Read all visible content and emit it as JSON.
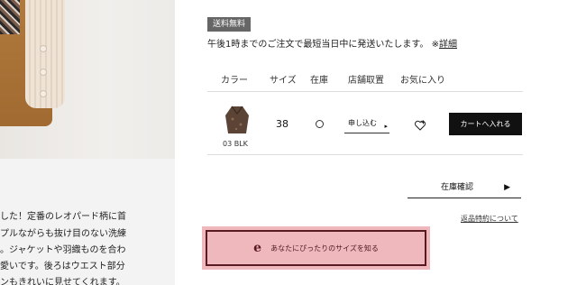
{
  "shipping": {
    "badge": "送料無料",
    "note": "午後1時までのご注文で最短当日中に発送いたします。",
    "mark": "※",
    "detail_link": "詳細"
  },
  "table": {
    "headers": [
      "カラー",
      "サイズ",
      "在庫",
      "店舗取置",
      "お気に入り"
    ],
    "row": {
      "color_label": "03 BLK",
      "size": "38",
      "stock_symbol": "○",
      "apply_label": "申し込む",
      "apply_arrow": "▸",
      "cart_label": "カートへ入れる"
    }
  },
  "stock_check": {
    "label": "在庫確認",
    "arrow": "▶"
  },
  "specs_link": "返品特約について",
  "size_fit": {
    "icon_letter": "e",
    "label": "あなたにぴったりのサイズを知る"
  },
  "description": {
    "lines": [
      "した！定番のレオパード柄に首",
      "プルながらも抜け目のない洗練",
      "。ジャケットや羽織ものを合わ",
      "愛いです。後ろはウエスト部分",
      "ンもきれいに見せてくれます。"
    ]
  },
  "colors": {
    "cart": "#111111",
    "size_fit_bg": "#efb8bd",
    "size_fit_border": "#5a1a24",
    "badge": "#666666"
  }
}
